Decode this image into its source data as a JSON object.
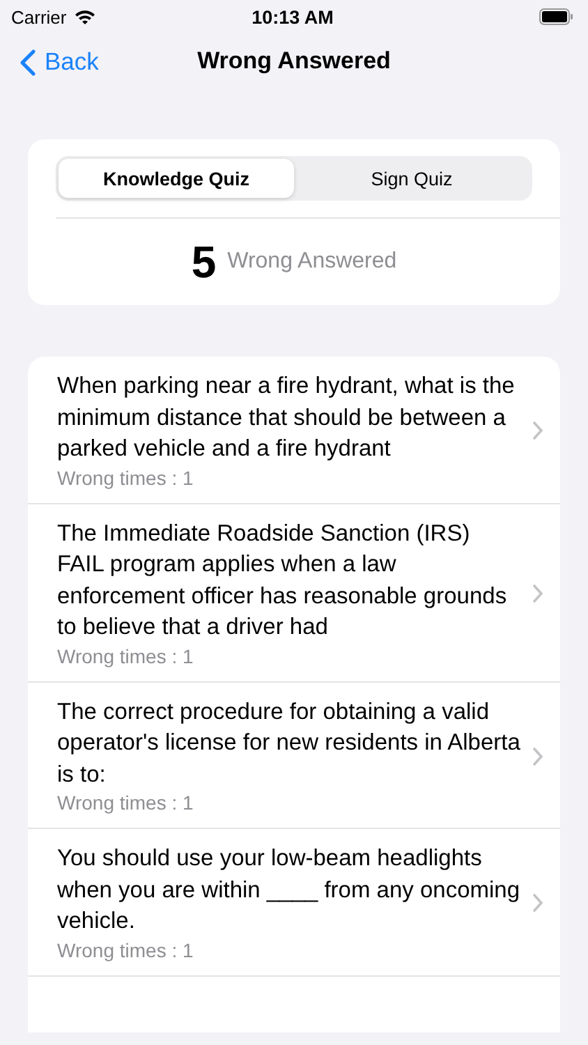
{
  "status_bar": {
    "carrier": "Carrier",
    "time": "10:13 AM"
  },
  "nav": {
    "back": "Back",
    "title": "Wrong Answered"
  },
  "segments": [
    {
      "label": "Knowledge Quiz",
      "selected": true
    },
    {
      "label": "Sign Quiz",
      "selected": false
    }
  ],
  "summary": {
    "count": "5",
    "label": "Wrong Answered"
  },
  "questions": [
    {
      "text": "When parking near a fire hydrant, what is the minimum distance that should be between a parked vehicle and a fire hydrant",
      "wrong_times": "Wrong times : 1"
    },
    {
      "text": "The Immediate Roadside Sanction (IRS) FAIL program applies when a law enforcement officer has reasonable grounds to believe that a driver had",
      "wrong_times": "Wrong times : 1"
    },
    {
      "text": "The correct procedure for obtaining a valid operator's license for new residents in Alberta is to:",
      "wrong_times": "Wrong times : 1"
    },
    {
      "text": "You should use your low-beam headlights when you are within ____ from any oncoming vehicle.",
      "wrong_times": "Wrong times : 1"
    }
  ]
}
